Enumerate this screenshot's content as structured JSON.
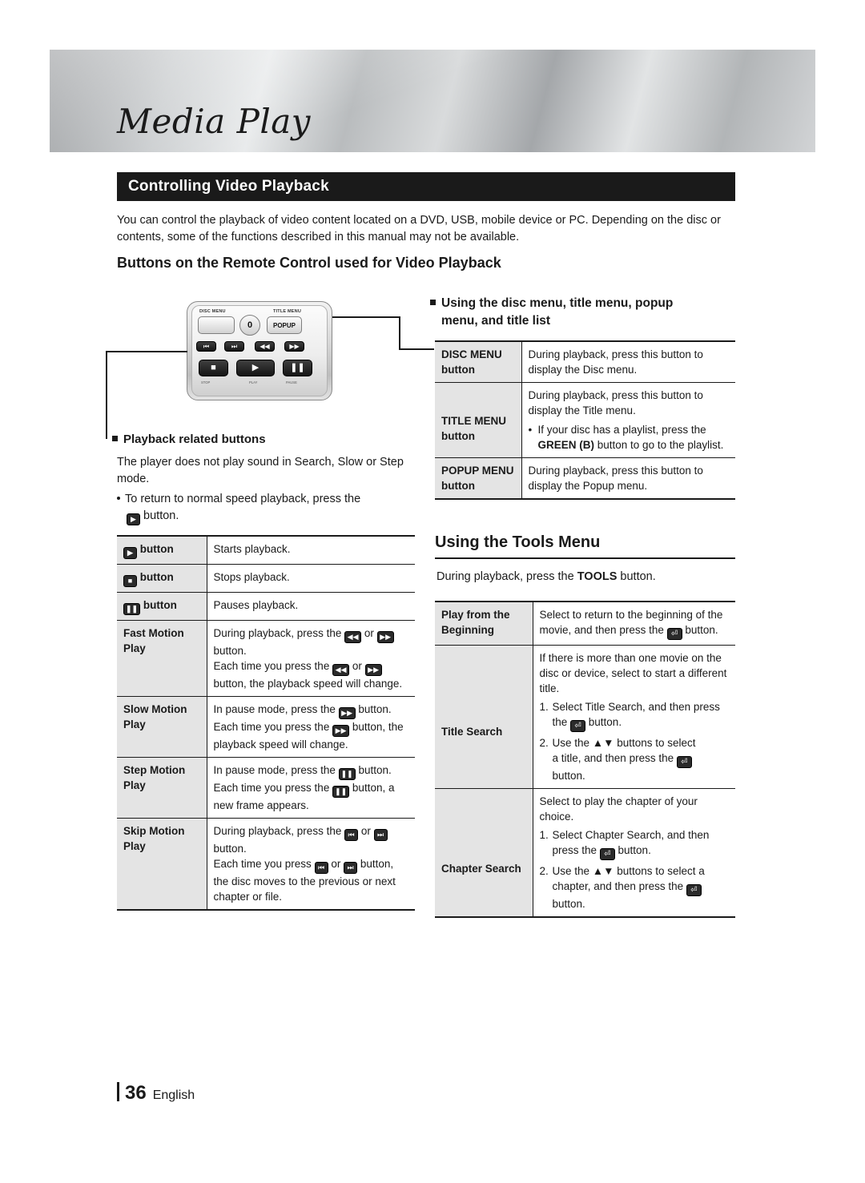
{
  "header": {
    "title": "Media Play"
  },
  "section": {
    "title": "Controlling Video Playback"
  },
  "intro": "You can control the playback of video content located on a DVD, USB, mobile device or PC. Depending on the disc or contents, some of the functions described in this manual may not be available.",
  "subheading": "Buttons on the Remote Control used for Video Playback",
  "remote": {
    "disc_menu_label": "DISC MENU",
    "title_menu_label": "TITLE MENU",
    "popup_label": "POPUP",
    "center_label": "0",
    "keys_row1": [
      "⏮",
      "⏭",
      "◀◀",
      "▶▶"
    ],
    "keys_row2": [
      "■",
      "▶",
      "❚❚"
    ],
    "bottom_labels": [
      "STOP",
      "PLAY",
      "PAUSE"
    ]
  },
  "playback_section": {
    "heading": "Playback related buttons",
    "paragraph": "The player does not play sound in Search, Slow or Step mode.",
    "bullet": "To return to normal speed playback, press the",
    "bullet_key": "▶",
    "bullet_tail": "button."
  },
  "playback_table": [
    {
      "key_glyph": "▶",
      "label": "button",
      "desc_lines": [
        "Starts playback."
      ]
    },
    {
      "key_glyph": "■",
      "label": "button",
      "desc_lines": [
        "Stops playback."
      ]
    },
    {
      "key_glyph": "❚❚",
      "label": "button",
      "desc_lines": [
        "Pauses playback."
      ]
    },
    {
      "label_lines": [
        "Fast Motion",
        "Play"
      ],
      "desc_rich": [
        "During playback, press the ◀◀ or ▶▶ button.",
        "Each time you press the ◀◀ or ▶▶ button, the playback speed will change."
      ]
    },
    {
      "label_lines": [
        "Slow Motion",
        "Play"
      ],
      "desc_rich": [
        "In pause mode, press the ▶▶ button.",
        "Each time you press the ▶▶ button, the playback speed will change."
      ]
    },
    {
      "label_lines": [
        "Step Motion",
        "Play"
      ],
      "desc_rich": [
        "In pause mode, press the ❚❚ button.",
        "Each time you press the ❚❚ button, a new frame appears."
      ]
    },
    {
      "label_lines": [
        "Skip Motion",
        "Play"
      ],
      "desc_rich": [
        "During playback, press the ⏮ or ⏭ button.",
        "Each time you press ⏮ or ⏭ button, the disc moves to the previous or next chapter or file."
      ]
    }
  ],
  "menu_section": {
    "heading_line1": "Using the disc menu, title menu, popup",
    "heading_line2": "menu, and title list"
  },
  "menu_table": [
    {
      "label_lines": [
        "DISC MENU",
        "button"
      ],
      "desc": "During playback, press this button to display the Disc menu."
    },
    {
      "label_lines": [
        "TITLE MENU",
        "button"
      ],
      "desc": "During playback, press this button to display the Title menu.",
      "bullet": "If your disc has a playlist, press the",
      "bullet_bold": "GREEN (B)",
      "bullet_tail": "button to go to the playlist."
    },
    {
      "label_lines": [
        "POPUP MENU",
        "button"
      ],
      "desc": "During playback, press this button to display the Popup menu."
    }
  ],
  "tools": {
    "heading": "Using the Tools Menu",
    "intro_pre": "During playback, press the",
    "intro_bold": "TOOLS",
    "intro_post": "button."
  },
  "tools_table": [
    {
      "label_lines": [
        "Play from the",
        "Beginning"
      ],
      "body": [
        "Select to return to the beginning of the movie, and then press the ⏎ button."
      ]
    },
    {
      "label_lines": [
        "Title Search"
      ],
      "body_intro": "If there is more than one movie on the disc or device, select to start a different title.",
      "steps": [
        "Select Title Search, and then press the ⏎ button.",
        "Use the ▲▼ buttons to select a title, and then press the ⏎ button."
      ]
    },
    {
      "label_lines": [
        "Chapter Search"
      ],
      "body_intro": "Select to play the chapter of your choice.",
      "steps": [
        "Select Chapter Search, and then press the ⏎ button.",
        "Use the ▲▼ buttons to select a chapter, and then press the ⏎ button."
      ]
    }
  ],
  "footer": {
    "page": "36",
    "language": "English"
  }
}
